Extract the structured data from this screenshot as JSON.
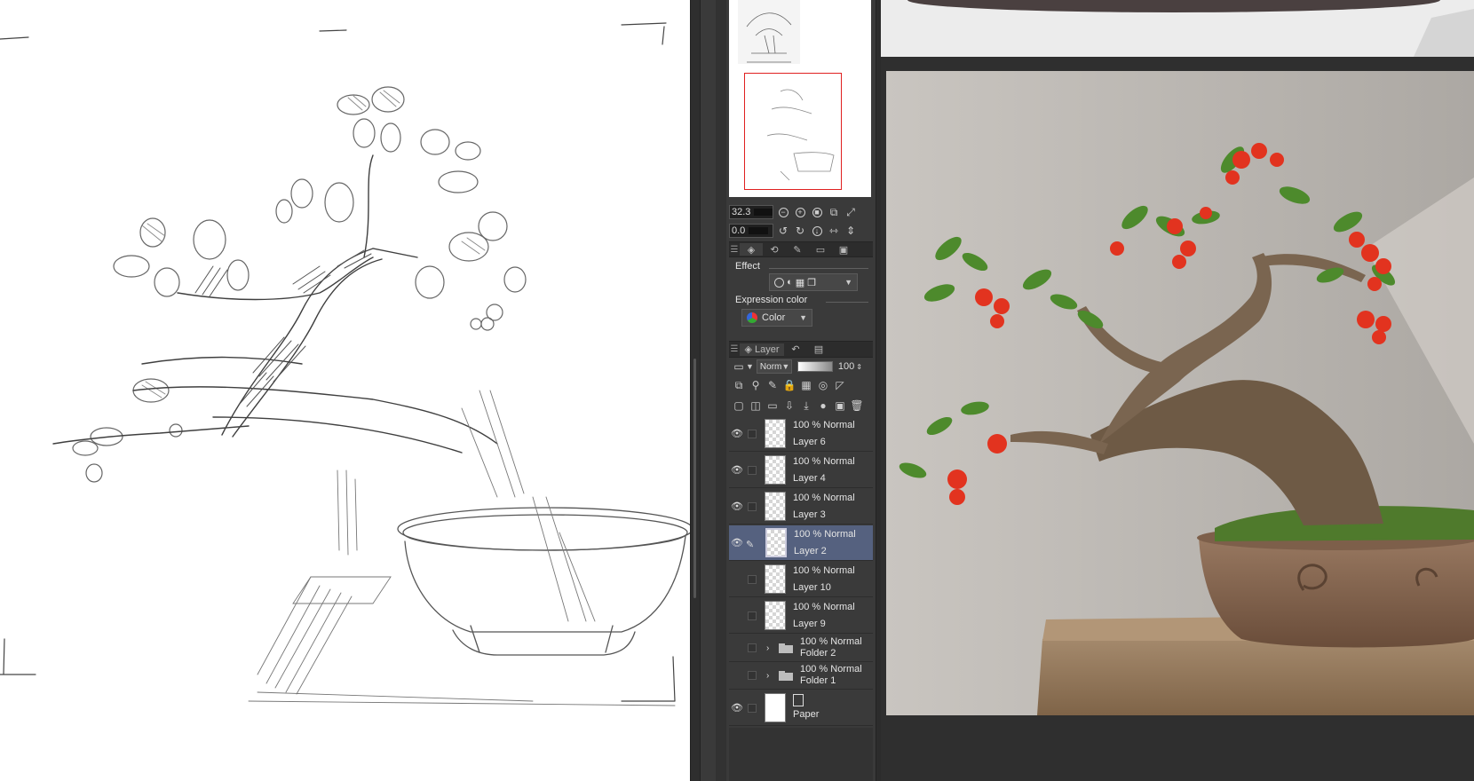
{
  "navigator": {
    "zoom_value": "32.3",
    "rotate_value": "0.0"
  },
  "tool_property": {
    "effect_label": "Effect",
    "expression_color_label": "Expression color",
    "expression_color_value": "Color"
  },
  "layer_panel": {
    "tab_label": "Layer",
    "blend_mode_value": "Norm",
    "opacity_value": "100",
    "layers": [
      {
        "info": "100 % Normal",
        "name": "Layer 6",
        "visible": true
      },
      {
        "info": "100 % Normal",
        "name": "Layer 4",
        "visible": true
      },
      {
        "info": "100 % Normal",
        "name": "Layer 3",
        "visible": true
      },
      {
        "info": "100 % Normal",
        "name": "Layer 2",
        "visible": true,
        "selected": true
      },
      {
        "info": "100 % Normal",
        "name": "Layer 10",
        "visible": false
      },
      {
        "info": "100 % Normal",
        "name": "Layer 9",
        "visible": false
      },
      {
        "info": "100 % Normal",
        "name": "Folder 2",
        "visible": false,
        "folder": true
      },
      {
        "info": "100 % Normal",
        "name": "Folder 1",
        "visible": false,
        "folder": true
      },
      {
        "info": "",
        "name": "Paper",
        "visible": true
      }
    ]
  },
  "colors": {
    "panel_bg": "#3a3a3a",
    "selected_layer": "#55617f",
    "navigator_frame": "#e02020",
    "berry_red": "#e2331f"
  },
  "icons": [
    "zoom-out-icon",
    "zoom-in-icon",
    "fit-icon",
    "rotate-left-icon",
    "rotate-right-icon",
    "eye-icon",
    "pen-icon",
    "folder-icon",
    "trash-icon",
    "new-layer-icon",
    "layers-icon"
  ]
}
